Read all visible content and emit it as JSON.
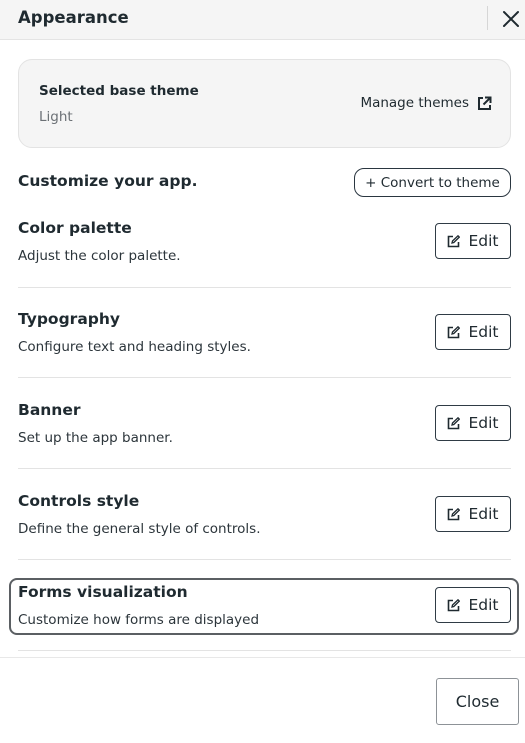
{
  "header": {
    "title": "Appearance",
    "close_icon": "close-icon"
  },
  "theme": {
    "label": "Selected base theme",
    "value": "Light",
    "manage_label": "Manage themes",
    "manage_icon": "external-link-icon"
  },
  "customize": {
    "title": "Customize your app.",
    "convert_label": "+ Convert to theme"
  },
  "sections": [
    {
      "title": "Color palette",
      "description": "Adjust the color palette.",
      "edit_label": "Edit"
    },
    {
      "title": "Typography",
      "description": "Configure text and heading styles.",
      "edit_label": "Edit"
    },
    {
      "title": "Banner",
      "description": "Set up the app banner.",
      "edit_label": "Edit"
    },
    {
      "title": "Controls style",
      "description": "Define the general style of controls.",
      "edit_label": "Edit"
    },
    {
      "title": "Forms visualization",
      "description": "Customize how forms are displayed",
      "edit_label": "Edit",
      "focused": true
    }
  ],
  "footer": {
    "close_label": "Close"
  }
}
